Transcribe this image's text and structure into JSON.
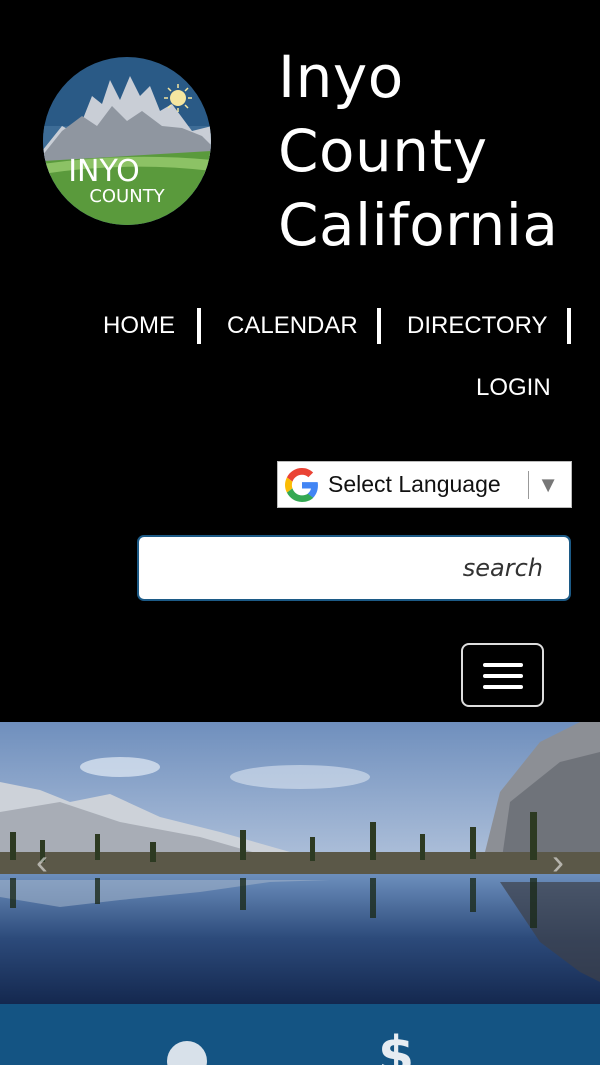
{
  "site": {
    "title_lines": [
      "Inyo",
      "County",
      "California"
    ],
    "logo_text_top": "INYO",
    "logo_text_bottom": "COUNTY"
  },
  "nav": {
    "items": [
      {
        "label": "HOME"
      },
      {
        "label": "CALENDAR"
      },
      {
        "label": "DIRECTORY"
      },
      {
        "label": "LOGIN"
      }
    ]
  },
  "language": {
    "label": "Select Language",
    "arrow": "▼"
  },
  "search": {
    "placeholder": "search"
  },
  "carousel": {
    "prev": "‹",
    "next": "›"
  },
  "quick_links": {
    "dollar_symbol": "$"
  },
  "colors": {
    "background": "#000000",
    "band_blue": "#145483",
    "search_border": "#1c5a86"
  }
}
